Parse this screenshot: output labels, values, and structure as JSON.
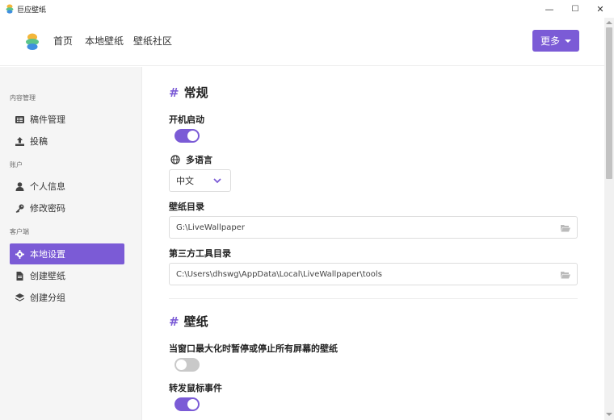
{
  "window": {
    "title": "巨应壁纸",
    "minimize": "—",
    "maximize": "☐",
    "close": "✕"
  },
  "nav": {
    "links": [
      "首页",
      "本地壁纸",
      "壁纸社区"
    ],
    "more_label": "更多"
  },
  "sidebar": {
    "sections": [
      {
        "title": "内容管理",
        "items": [
          "稿件管理",
          "投稿"
        ]
      },
      {
        "title": "账户",
        "items": [
          "个人信息",
          "修改密码"
        ]
      },
      {
        "title": "客户端",
        "items": [
          "本地设置",
          "创建壁纸",
          "创建分组"
        ]
      }
    ],
    "active_item": "本地设置"
  },
  "settings": {
    "general": {
      "title": "常规",
      "autostart_label": "开机启动",
      "autostart_on": true,
      "language_label": "多语言",
      "language_value": "中文",
      "wallpaper_dir_label": "壁纸目录",
      "wallpaper_dir_value": "G:\\LiveWallpaper",
      "tools_dir_label": "第三方工具目录",
      "tools_dir_value": "C:\\Users\\dhswg\\AppData\\Local\\LiveWallpaper\\tools"
    },
    "wallpaper": {
      "title": "壁纸",
      "pause_label": "当窗口最大化时暂停或停止所有屏幕的壁纸",
      "pause_on": false,
      "forward_mouse_label": "转发鼠标事件",
      "forward_mouse_on": true
    },
    "hash": "#"
  },
  "colors": {
    "accent": "#7b5bd6"
  }
}
